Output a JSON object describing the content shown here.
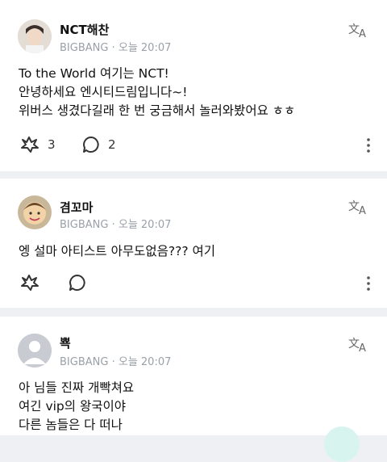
{
  "posts": [
    {
      "author": "NCT해찬",
      "group": "BIGBANG",
      "separator": "·",
      "time": "오늘 20:07",
      "lines": [
        "To the World 여기는 NCT!",
        "안녕하세요 엔시티드림입니다~!",
        "위버스 생겼다길래 한 번 궁금해서 놀러와봤어요 ㅎㅎ"
      ],
      "like_count": "3",
      "comment_count": "2"
    },
    {
      "author": "겸꼬마",
      "group": "BIGBANG",
      "separator": "·",
      "time": "오늘 20:07",
      "lines": [
        "엥 설마 아티스트 아무도없음??? 여기"
      ],
      "like_count": "",
      "comment_count": ""
    },
    {
      "author": "뾱",
      "group": "BIGBANG",
      "separator": "·",
      "time": "오늘 20:07",
      "lines": [
        "아 님들 진짜 개빡쳐요",
        "여긴 vip의 왕국이야",
        "다른 놈들은 다 떠나"
      ],
      "like_count": "",
      "comment_count": ""
    }
  ],
  "colors": {
    "background": "#eef0f3",
    "card": "#ffffff",
    "meta": "#9aa0a8",
    "icon": "#333333",
    "fab": "#d7f4ef"
  }
}
